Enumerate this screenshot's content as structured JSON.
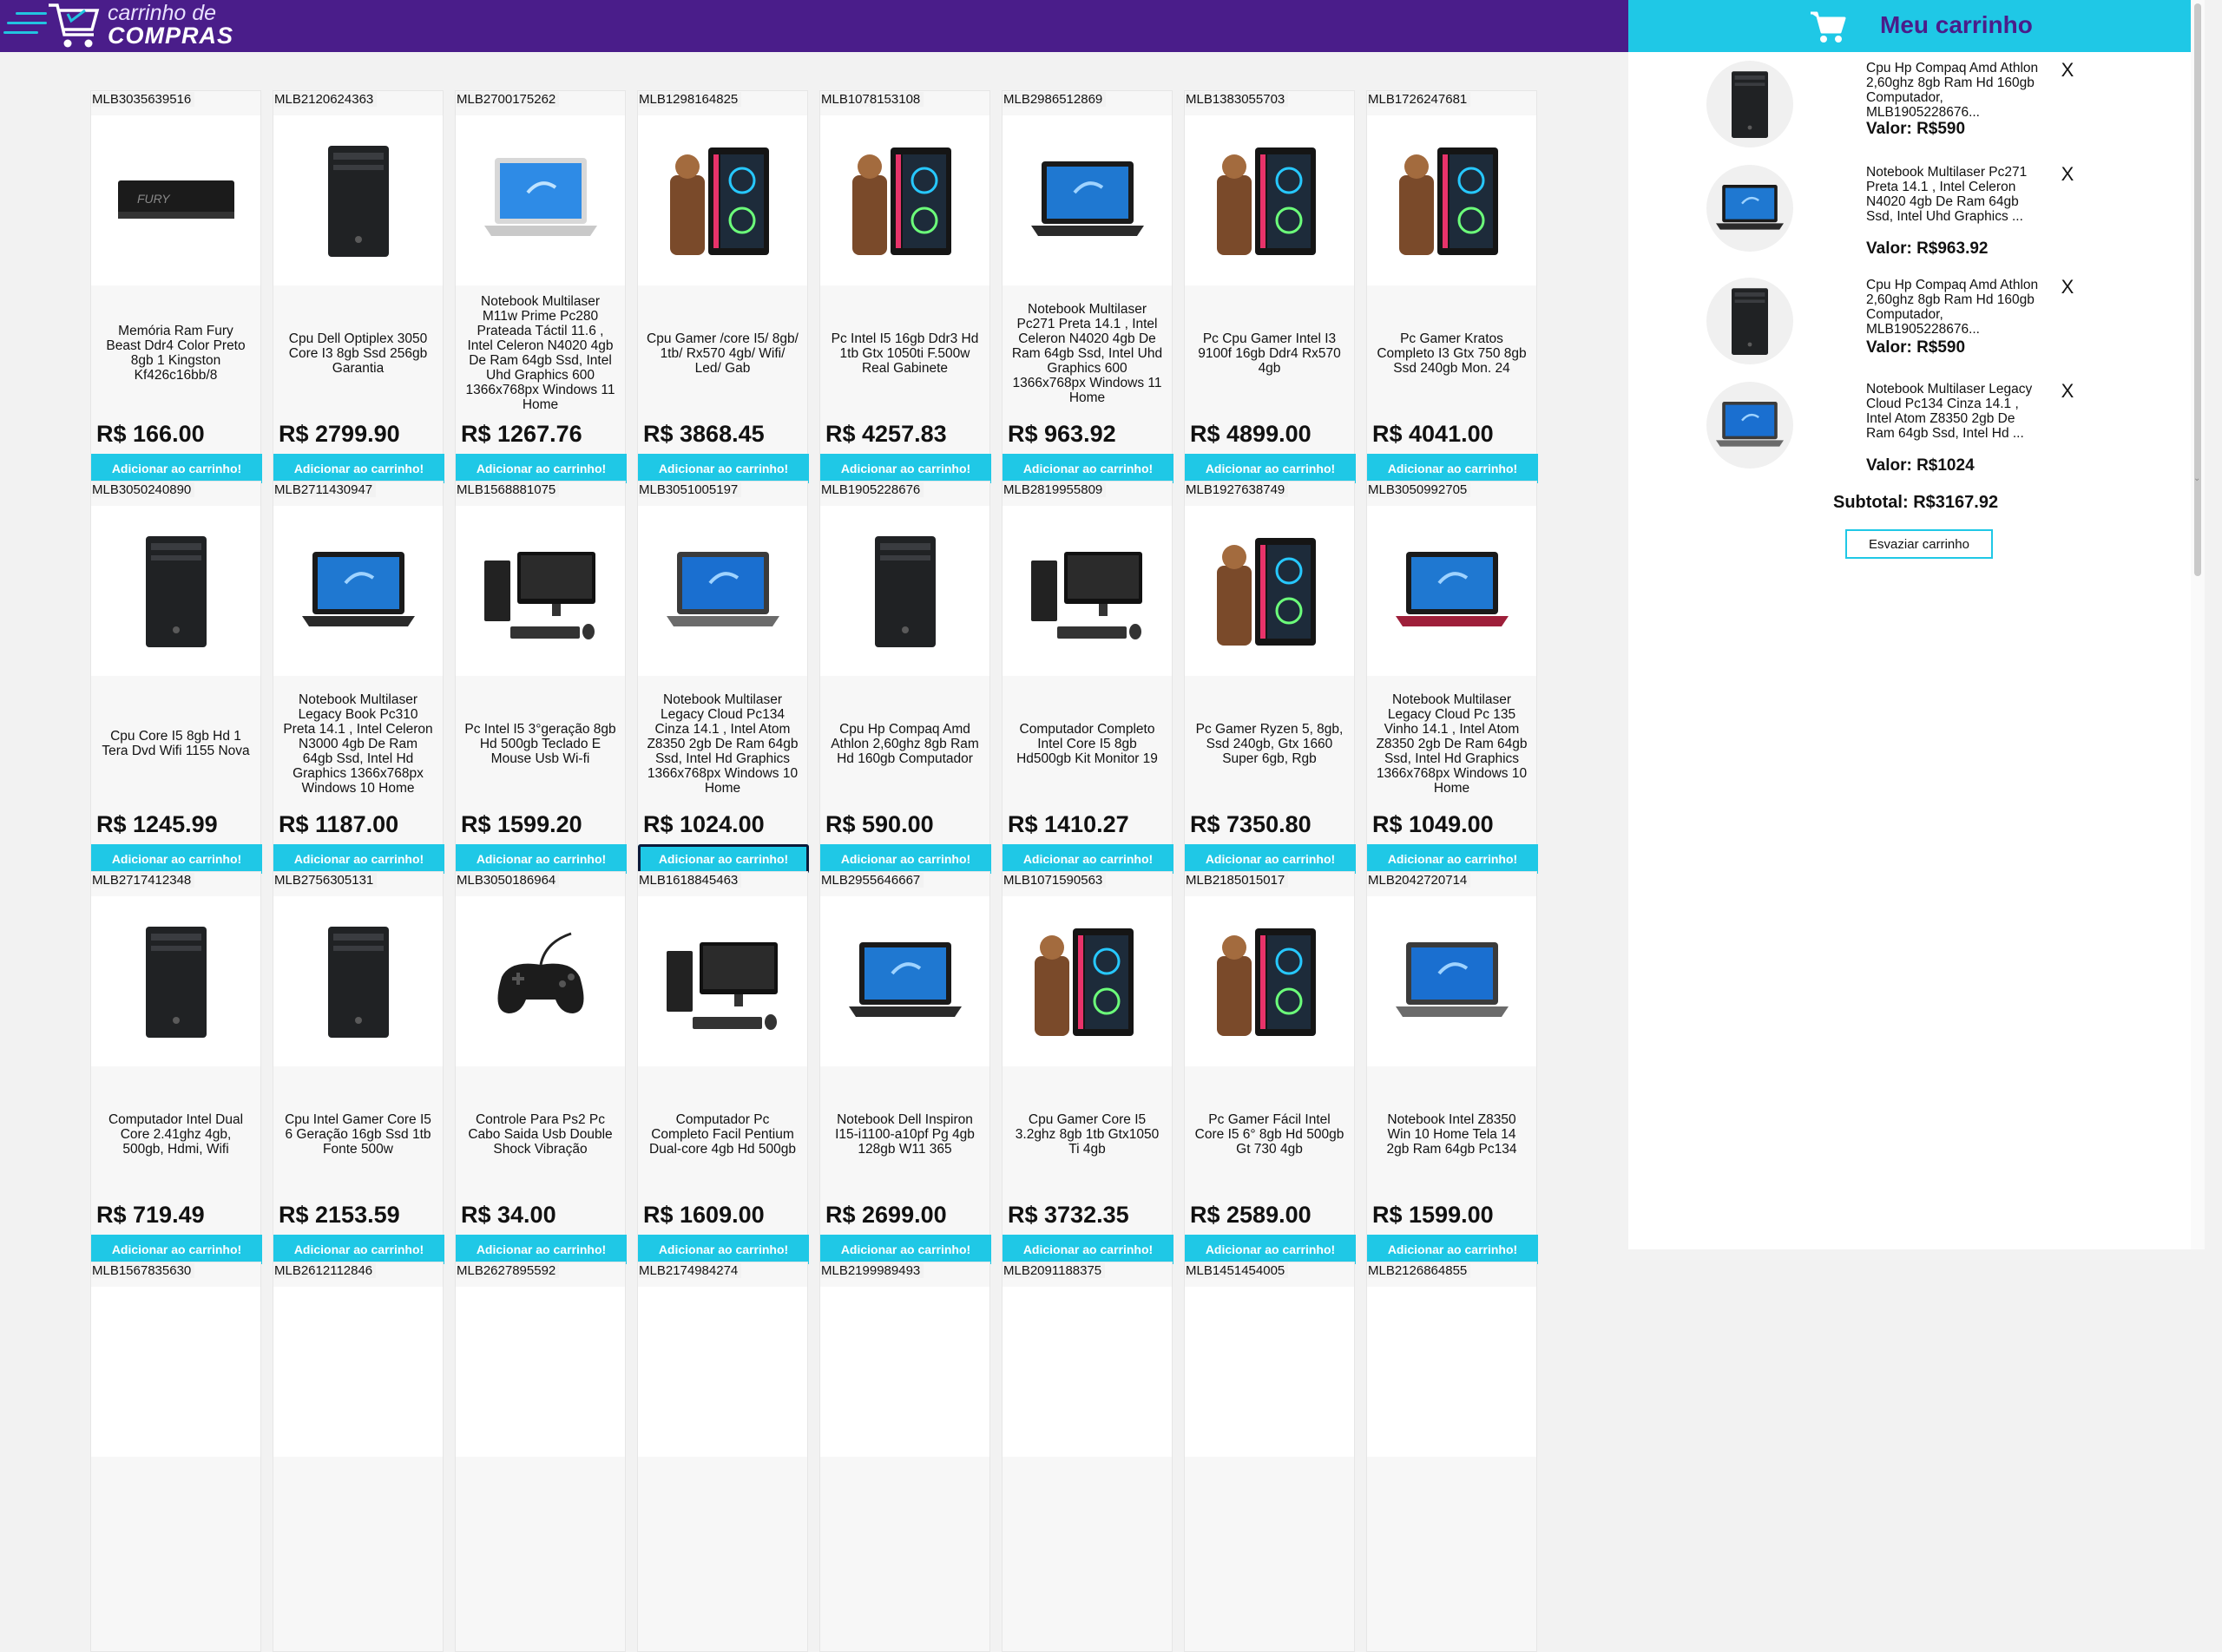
{
  "header": {
    "logo_line1": "carrinho de",
    "logo_line2": "COMPRAS",
    "accent_color": "#4a1d8a",
    "highlight_color": "#1fc8e6"
  },
  "products": [
    {
      "id": "MLB3035639516",
      "title": "Memória Ram Fury Beast Ddr4 Color Preto 8gb 1 Kingston Kf426c16bb/8",
      "price": "R$ 166.00",
      "icon": "ram-stick-image",
      "button": "Adicionar ao carrinho!"
    },
    {
      "id": "MLB2120624363",
      "title": "Cpu Dell Optiplex 3050 Core I3 8gb Ssd 256gb Garantia",
      "price": "R$ 2799.90",
      "icon": "desktop-tower-image",
      "button": "Adicionar ao carrinho!"
    },
    {
      "id": "MLB2700175262",
      "title": "Notebook Multilaser M11w Prime Pc280 Prateada Táctil 11.6 , Intel Celeron N4020 4gb De Ram 64gb Ssd, Intel Uhd Graphics 600 1366x768px Windows 11 Home",
      "price": "R$ 1267.76",
      "icon": "laptop-silver-image",
      "button": "Adicionar ao carrinho!"
    },
    {
      "id": "MLB1298164825",
      "title": "Cpu Gamer /core I5/ 8gb/ 1tb/ Rx570 4gb/ Wifi/ Led/ Gab",
      "price": "R$ 3868.45",
      "icon": "gamer-pc-image",
      "button": "Adicionar ao carrinho!"
    },
    {
      "id": "MLB1078153108",
      "title": "Pc Intel I5 16gb Ddr3 Hd 1tb Gtx 1050ti F.500w Real Gabinete",
      "price": "R$ 4257.83",
      "icon": "gamer-pc-image",
      "button": "Adicionar ao carrinho!"
    },
    {
      "id": "MLB2986512869",
      "title": "Notebook Multilaser Pc271 Preta 14.1 , Intel Celeron N4020 4gb De Ram 64gb Ssd, Intel Uhd Graphics 600 1366x768px Windows 11 Home",
      "price": "R$ 963.92",
      "icon": "laptop-black-image",
      "button": "Adicionar ao carrinho!"
    },
    {
      "id": "MLB1383055703",
      "title": "Pc Cpu Gamer Intel I3 9100f 16gb Ddr4 Rx570 4gb",
      "price": "R$ 4899.00",
      "icon": "gamer-pc-image",
      "button": "Adicionar ao carrinho!"
    },
    {
      "id": "MLB1726247681",
      "title": "Pc Gamer Kratos Completo I3 Gtx 750 8gb Ssd 240gb Mon. 24",
      "price": "R$ 4041.00",
      "icon": "gamer-pc-image",
      "button": "Adicionar ao carrinho!"
    },
    {
      "id": "MLB3050240890",
      "title": "Cpu Core I5 8gb Hd 1 Tera Dvd Wifi 1155 Nova",
      "price": "R$ 1245.99",
      "icon": "desktop-tower-image",
      "button": "Adicionar ao carrinho!"
    },
    {
      "id": "MLB2711430947",
      "title": "Notebook Multilaser Legacy Book Pc310 Preta 14.1 , Intel Celeron N3000 4gb De Ram 64gb Ssd, Intel Hd Graphics 1366x768px Windows 10 Home",
      "price": "R$ 1187.00",
      "icon": "laptop-black-image",
      "button": "Adicionar ao carrinho!"
    },
    {
      "id": "MLB1568881075",
      "title": "Pc Intel I5 3°geração 8gb Hd 500gb Teclado E Mouse Usb Wi-fi",
      "price": "R$ 1599.20",
      "icon": "desktop-kit-image",
      "button": "Adicionar ao carrinho!"
    },
    {
      "id": "MLB3051005197",
      "title": "Notebook Multilaser Legacy Cloud Pc134 Cinza 14.1 , Intel Atom Z8350 2gb De Ram 64gb Ssd, Intel Hd Graphics 1366x768px Windows 10 Home",
      "price": "R$ 1024.00",
      "icon": "laptop-grey-image",
      "button": "Adicionar ao carrinho!",
      "focused": true
    },
    {
      "id": "MLB1905228676",
      "title": "Cpu Hp Compaq Amd Athlon 2,60ghz 8gb Ram Hd 160gb Computador",
      "price": "R$ 590.00",
      "icon": "desktop-tower-image",
      "button": "Adicionar ao carrinho!"
    },
    {
      "id": "MLB2819955809",
      "title": "Computador Completo Intel Core I5 8gb Hd500gb Kit Monitor 19",
      "price": "R$ 1410.27",
      "icon": "desktop-kit-image",
      "button": "Adicionar ao carrinho!"
    },
    {
      "id": "MLB1927638749",
      "title": "Pc Gamer Ryzen 5, 8gb, Ssd 240gb, Gtx 1660 Super 6gb, Rgb",
      "price": "R$ 7350.80",
      "icon": "gamer-pc-image",
      "button": "Adicionar ao carrinho!"
    },
    {
      "id": "MLB3050992705",
      "title": "Notebook Multilaser Legacy Cloud Pc 135 Vinho 14.1 , Intel Atom Z8350 2gb De Ram 64gb Ssd, Intel Hd Graphics 1366x768px Windows 10 Home",
      "price": "R$ 1049.00",
      "icon": "laptop-red-image",
      "button": "Adicionar ao carrinho!"
    },
    {
      "id": "MLB2717412348",
      "title": "Computador Intel Dual Core 2.41ghz 4gb, 500gb, Hdmi, Wifi",
      "price": "R$ 719.49",
      "icon": "desktop-tower-image",
      "button": "Adicionar ao carrinho!"
    },
    {
      "id": "MLB2756305131",
      "title": "Cpu Intel Gamer Core I5 6 Geração 16gb Ssd 1tb Fonte 500w",
      "price": "R$ 2153.59",
      "icon": "desktop-tower-image",
      "button": "Adicionar ao carrinho!"
    },
    {
      "id": "MLB3050186964",
      "title": "Controle Para Ps2 Pc Cabo Saida Usb Double Shock Vibração",
      "price": "R$ 34.00",
      "icon": "gamepad-image",
      "button": "Adicionar ao carrinho!"
    },
    {
      "id": "MLB1618845463",
      "title": "Computador Pc Completo Facil Pentium Dual-core 4gb Hd 500gb",
      "price": "R$ 1609.00",
      "icon": "desktop-kit-image",
      "button": "Adicionar ao carrinho!"
    },
    {
      "id": "MLB2955646667",
      "title": "Notebook Dell Inspiron I15-i1100-a10pf Pg 4gb 128gb W11 365",
      "price": "R$ 2699.00",
      "icon": "laptop-black-image",
      "button": "Adicionar ao carrinho!"
    },
    {
      "id": "MLB1071590563",
      "title": "Cpu Gamer Core I5 3.2ghz 8gb 1tb Gtx1050 Ti 4gb",
      "price": "R$ 3732.35",
      "icon": "gamer-pc-image",
      "button": "Adicionar ao carrinho!"
    },
    {
      "id": "MLB2185015017",
      "title": "Pc Gamer Fácil Intel Core I5 6° 8gb Hd 500gb Gt 730 4gb",
      "price": "R$ 2589.00",
      "icon": "gamer-pc-image",
      "button": "Adicionar ao carrinho!"
    },
    {
      "id": "MLB2042720714",
      "title": "Notebook Intel Z8350 Win 10 Home Tela 14 2gb Ram 64gb Pc134",
      "price": "R$ 1599.00",
      "icon": "laptop-grey-image",
      "button": "Adicionar ao carrinho!"
    },
    {
      "id": "MLB1567835630",
      "title": "",
      "price": "",
      "icon": "",
      "button": ""
    },
    {
      "id": "MLB2612112846",
      "title": "",
      "price": "",
      "icon": "",
      "button": ""
    },
    {
      "id": "MLB2627895592",
      "title": "",
      "price": "",
      "icon": "",
      "button": ""
    },
    {
      "id": "MLB2174984274",
      "title": "",
      "price": "",
      "icon": "",
      "button": ""
    },
    {
      "id": "MLB2199989493",
      "title": "",
      "price": "",
      "icon": "",
      "button": ""
    },
    {
      "id": "MLB2091188375",
      "title": "",
      "price": "",
      "icon": "",
      "button": ""
    },
    {
      "id": "MLB1451454005",
      "title": "",
      "price": "",
      "icon": "",
      "button": ""
    },
    {
      "id": "MLB2126864855",
      "title": "",
      "price": "",
      "icon": "",
      "button": ""
    }
  ],
  "cart": {
    "title": "Meu carrinho",
    "items": [
      {
        "name": "Cpu Hp Compaq Amd Athlon 2,60ghz 8gb Ram Hd 160gb Computador, MLB1905228676...",
        "value": "Valor: R$590",
        "icon": "desktop-tower-image",
        "remove": "X"
      },
      {
        "name": "Notebook Multilaser Pc271 Preta 14.1 , Intel Celeron N4020 4gb De Ram 64gb Ssd, Intel Uhd Graphics ...",
        "value": "Valor: R$963.92",
        "icon": "laptop-black-image",
        "remove": "X"
      },
      {
        "name": "Cpu Hp Compaq Amd Athlon 2,60ghz 8gb Ram Hd 160gb Computador, MLB1905228676...",
        "value": "Valor: R$590",
        "icon": "desktop-tower-image",
        "remove": "X"
      },
      {
        "name": "Notebook Multilaser Legacy Cloud Pc134 Cinza 14.1 , Intel Atom Z8350 2gb De Ram 64gb Ssd, Intel Hd ...",
        "value": "Valor: R$1024",
        "icon": "laptop-grey-image",
        "remove": "X"
      }
    ],
    "subtotal": "Subtotal: R$3167.92",
    "empty_button": "Esvaziar carrinho"
  }
}
